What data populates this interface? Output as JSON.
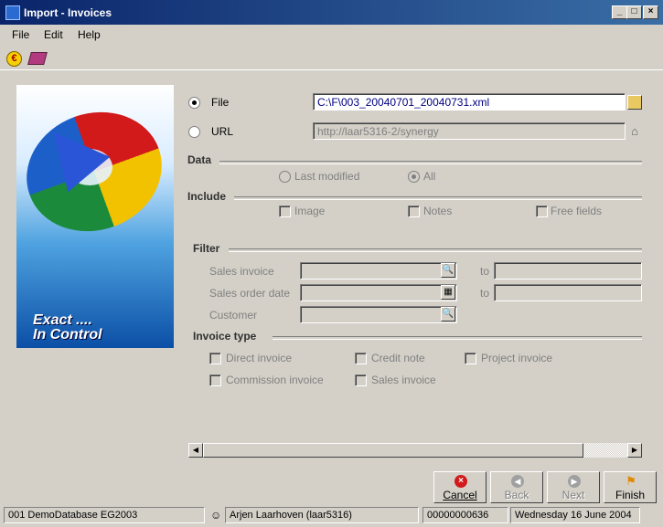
{
  "window": {
    "title": "Import - Invoices"
  },
  "menu": {
    "file": "File",
    "edit": "Edit",
    "help": "Help"
  },
  "splash": {
    "line1": "Exact ....",
    "line2": "In Control"
  },
  "source": {
    "file_label": "File",
    "file_value": "C:\\F\\003_20040701_20040731.xml",
    "url_label": "URL",
    "url_value": "http://laar5316-2/synergy"
  },
  "data_section": {
    "title": "Data",
    "last_modified": "Last modified",
    "all": "All"
  },
  "include_section": {
    "title": "Include",
    "image": "Image",
    "notes": "Notes",
    "free_fields": "Free fields"
  },
  "filter": {
    "title": "Filter",
    "sales_invoice": "Sales invoice",
    "sales_order_date": "Sales order date",
    "customer": "Customer",
    "to": "to"
  },
  "invoice_type": {
    "title": "Invoice type",
    "direct": "Direct invoice",
    "credit": "Credit note",
    "project": "Project invoice",
    "commission": "Commission invoice",
    "sales": "Sales invoice"
  },
  "buttons": {
    "cancel": "Cancel",
    "back": "Back",
    "next": "Next",
    "finish": "Finish"
  },
  "status": {
    "database": "001 DemoDatabase EG2003",
    "user": "Arjen Laarhoven (laar5316)",
    "number": "00000000636",
    "date": "Wednesday 16 June 2004"
  }
}
